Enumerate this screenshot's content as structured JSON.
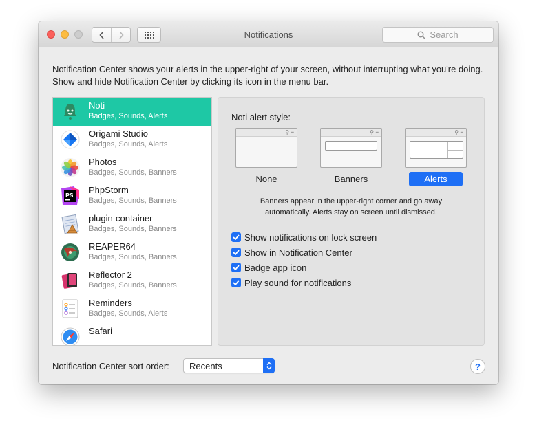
{
  "window": {
    "title": "Notifications"
  },
  "search": {
    "placeholder": "Search"
  },
  "description": "Notification Center shows your alerts in the upper-right of your screen, without interrupting what you're doing. Show and hide Notification Center by clicking its icon in the menu bar.",
  "apps": [
    {
      "name": "Noti",
      "detail": "Badges, Sounds, Alerts",
      "icon": "noti-icon",
      "selected": true
    },
    {
      "name": "Origami Studio",
      "detail": "Badges, Sounds, Alerts",
      "icon": "origami-studio-icon"
    },
    {
      "name": "Photos",
      "detail": "Badges, Sounds, Banners",
      "icon": "photos-icon"
    },
    {
      "name": "PhpStorm",
      "detail": "Badges, Sounds, Banners",
      "icon": "phpstorm-icon"
    },
    {
      "name": "plugin-container",
      "detail": "Badges, Sounds, Banners",
      "icon": "plugin-container-icon"
    },
    {
      "name": "REAPER64",
      "detail": "Badges, Sounds, Banners",
      "icon": "reaper-icon"
    },
    {
      "name": "Reflector 2",
      "detail": "Badges, Sounds, Banners",
      "icon": "reflector-icon"
    },
    {
      "name": "Reminders",
      "detail": "Badges, Sounds, Alerts",
      "icon": "reminders-icon"
    },
    {
      "name": "Safari",
      "detail": "",
      "icon": "safari-icon"
    }
  ],
  "alert_style": {
    "title": "Noti alert style:",
    "options": [
      "None",
      "Banners",
      "Alerts"
    ],
    "selected": "Alerts",
    "description": "Banners appear in the upper-right corner and go away automatically. Alerts stay on screen until dismissed."
  },
  "checkboxes": [
    {
      "label": "Show notifications on lock screen",
      "checked": true
    },
    {
      "label": "Show in Notification Center",
      "checked": true
    },
    {
      "label": "Badge app icon",
      "checked": true
    },
    {
      "label": "Play sound for notifications",
      "checked": true
    }
  ],
  "sort": {
    "label": "Notification Center sort order:",
    "value": "Recents"
  },
  "help": {
    "label": "?"
  },
  "colors": {
    "selection": "#1ec8a5",
    "accent": "#1e6ff5",
    "close": "#fc605c",
    "minimize": "#fdbc40"
  }
}
